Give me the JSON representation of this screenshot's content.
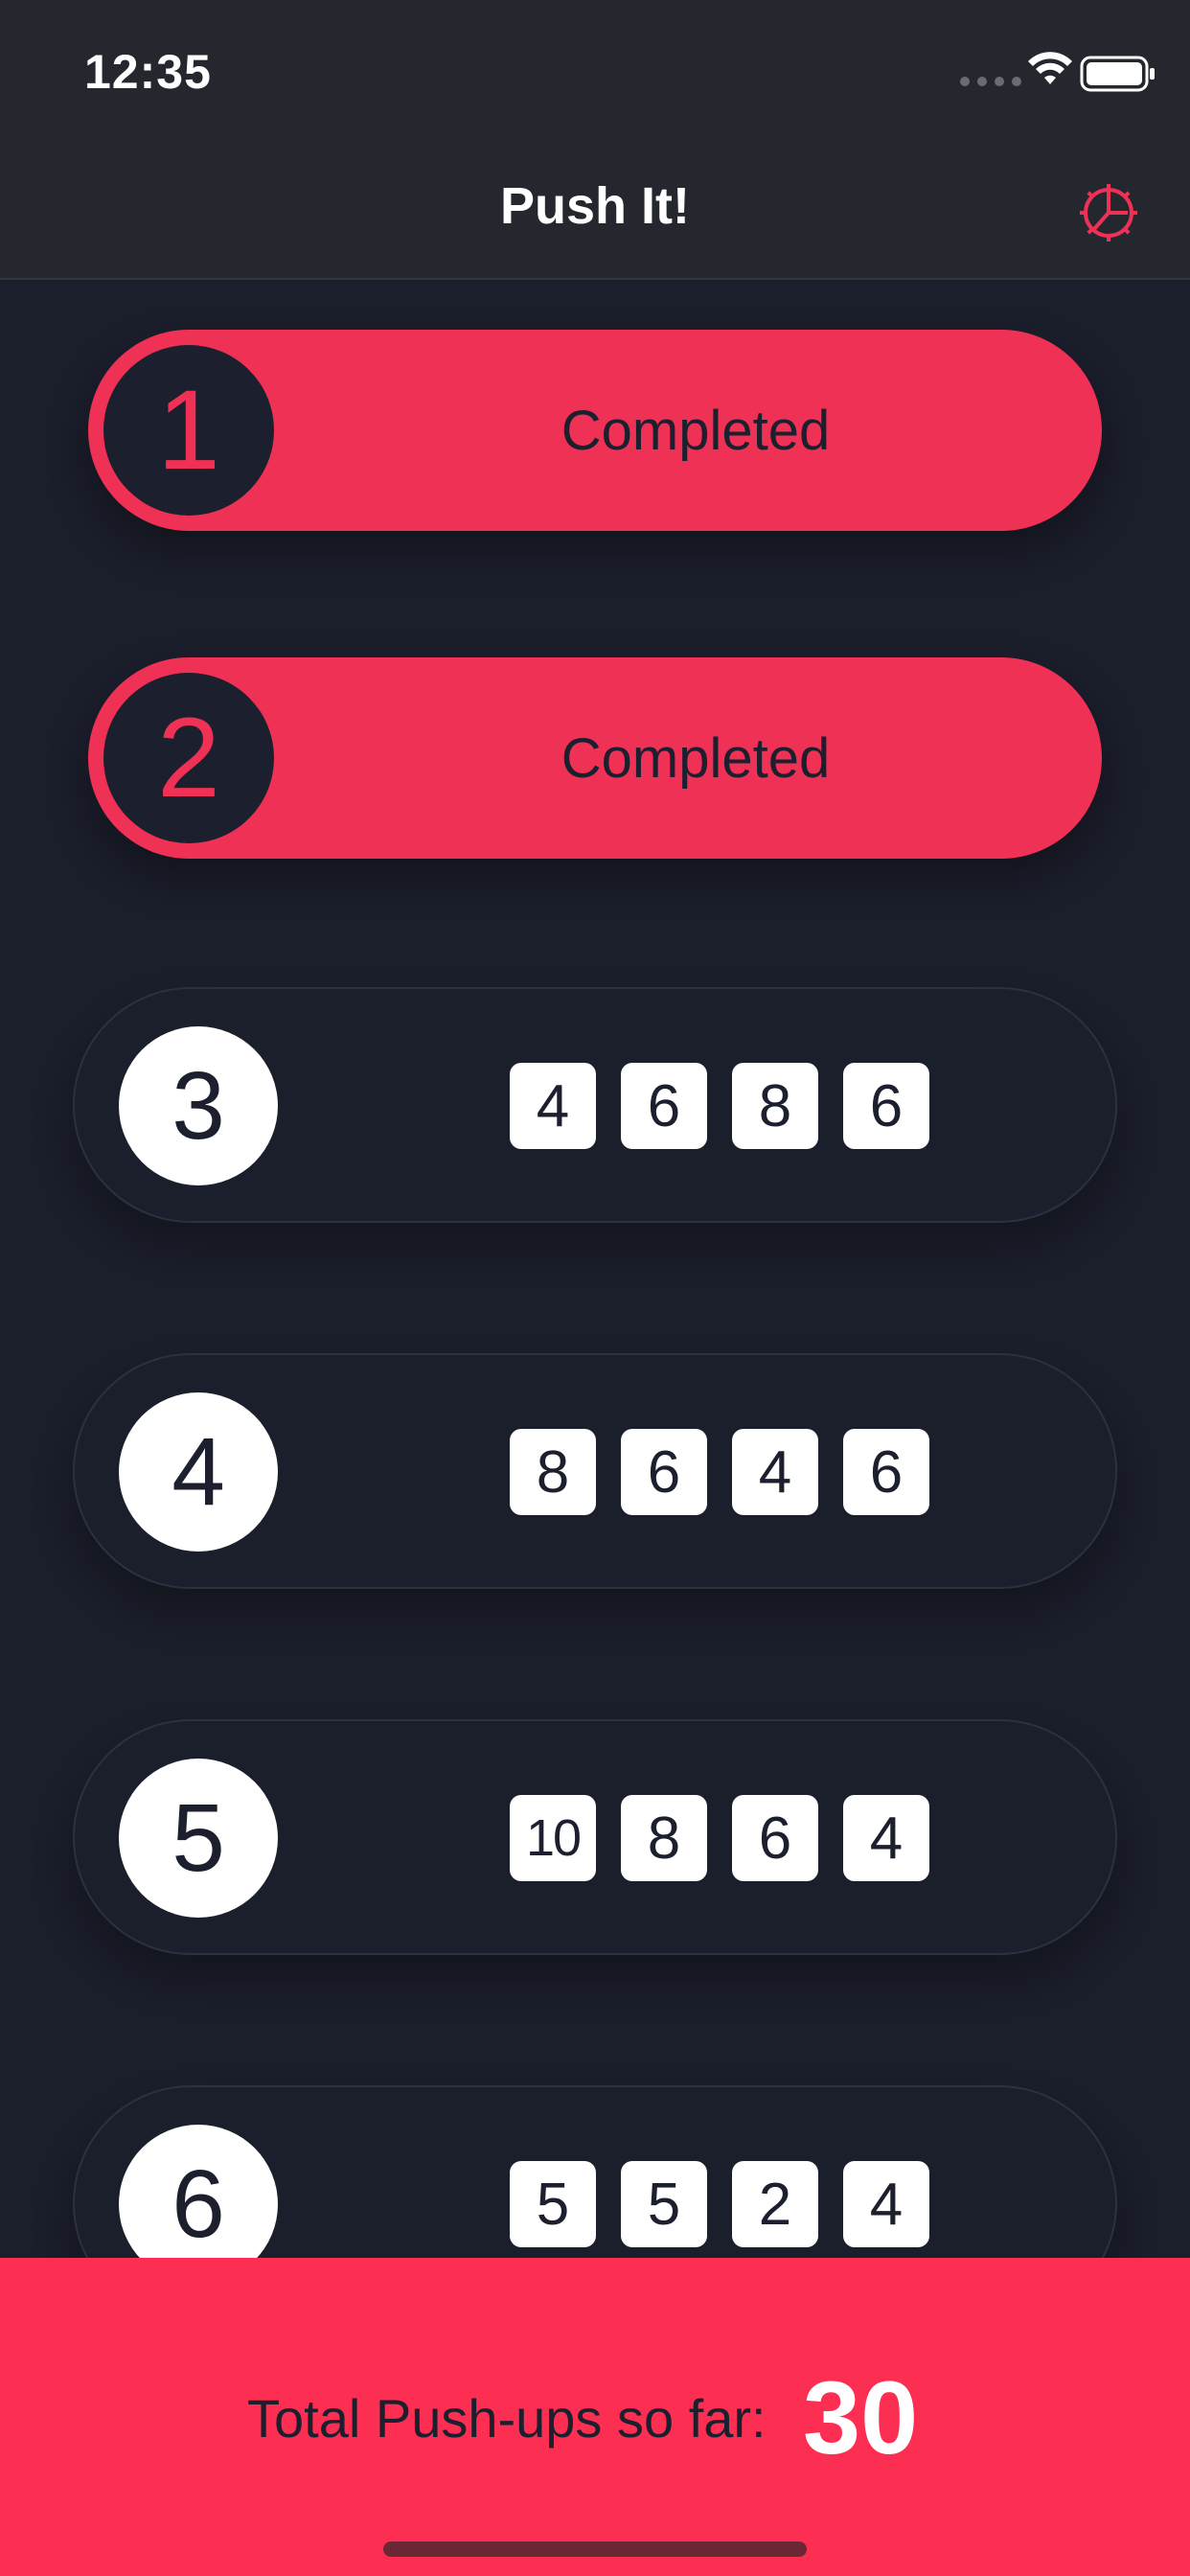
{
  "status_bar": {
    "time": "12:35"
  },
  "header": {
    "title": "Push It!",
    "settings_icon": "gear-icon"
  },
  "days": [
    {
      "number": "1",
      "status": "Completed"
    },
    {
      "number": "2",
      "status": "Completed"
    },
    {
      "number": "3",
      "reps": [
        "4",
        "6",
        "8",
        "6"
      ]
    },
    {
      "number": "4",
      "reps": [
        "8",
        "6",
        "4",
        "6"
      ]
    },
    {
      "number": "5",
      "reps": [
        "10",
        "8",
        "6",
        "4"
      ]
    },
    {
      "number": "6",
      "reps": [
        "5",
        "5",
        "2",
        "4"
      ]
    }
  ],
  "footer": {
    "total_label": "Total Push-ups so far:",
    "total_value": "30"
  },
  "colors": {
    "accent": "#ee3155",
    "background": "#1b1e2b",
    "footer": "#fc2e51"
  }
}
